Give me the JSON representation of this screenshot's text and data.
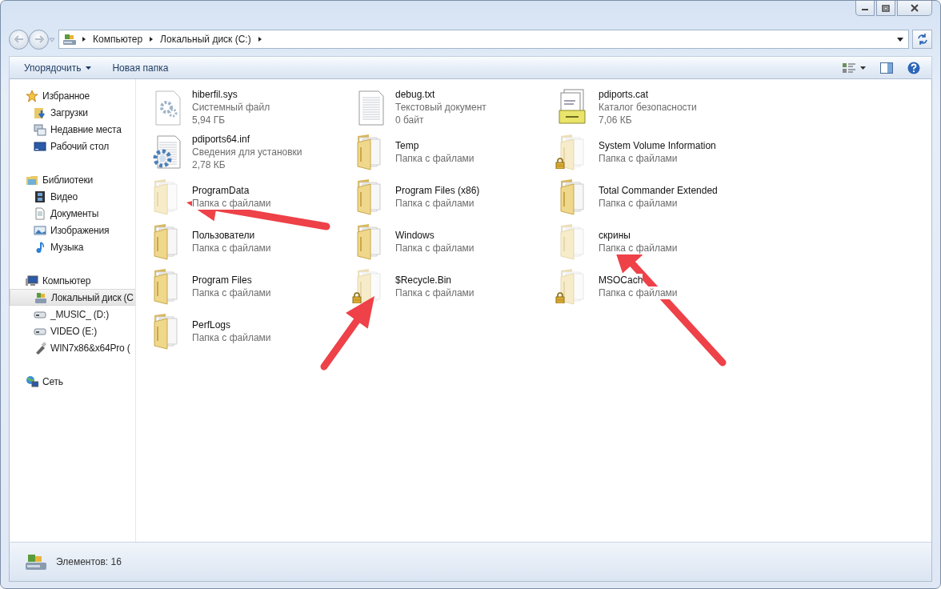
{
  "address_bar": {
    "path": [
      {
        "label": "Компьютер"
      },
      {
        "label": "Локальный диск (C:)"
      }
    ]
  },
  "toolbar": {
    "organize": "Упорядочить",
    "new_folder": "Новая папка"
  },
  "navigation": [
    {
      "label": "Избранное",
      "kind": "favorites",
      "selected": false,
      "children": [
        {
          "label": "Загрузки",
          "kind": "downloads",
          "selected": false
        },
        {
          "label": "Недавние места",
          "kind": "recent",
          "selected": false
        },
        {
          "label": "Рабочий стол",
          "kind": "desktop",
          "selected": false
        }
      ]
    },
    {
      "label": "Библиотеки",
      "kind": "libraries",
      "selected": false,
      "children": [
        {
          "label": "Видео",
          "kind": "video",
          "selected": false
        },
        {
          "label": "Документы",
          "kind": "documents",
          "selected": false
        },
        {
          "label": "Изображения",
          "kind": "pictures",
          "selected": false
        },
        {
          "label": "Музыка",
          "kind": "music",
          "selected": false
        }
      ]
    },
    {
      "label": "Компьютер",
      "kind": "computer",
      "selected": false,
      "children": [
        {
          "label": "Локальный диск (C",
          "kind": "system-drive",
          "selected": true
        },
        {
          "label": "_MUSIC_ (D:)",
          "kind": "drive",
          "selected": false
        },
        {
          "label": "VIDEO (E:)",
          "kind": "drive",
          "selected": false
        },
        {
          "label": "WIN7x86&x64Pro (",
          "kind": "usb",
          "selected": false
        }
      ]
    },
    {
      "label": "Сеть",
      "kind": "network",
      "selected": false
    }
  ],
  "columns": [
    [
      {
        "name": "hiberfil.sys",
        "kind": "system-file",
        "details": [
          "Системный файл",
          "5,94 ГБ"
        ],
        "hidden": false,
        "locked": false
      },
      {
        "name": "pdiports64.inf",
        "kind": "setup-file",
        "details": [
          "Сведения для установки",
          "2,78 КБ"
        ],
        "hidden": false,
        "locked": false
      },
      {
        "name": "ProgramData",
        "kind": "folder",
        "details": [
          "Папка с файлами"
        ],
        "hidden": true,
        "locked": false
      },
      {
        "name": "Пользователи",
        "kind": "folder",
        "details": [
          "Папка с файлами"
        ],
        "hidden": false,
        "locked": false
      },
      {
        "name": "Program Files",
        "kind": "folder",
        "details": [
          "Папка с файлами"
        ],
        "hidden": false,
        "locked": false
      },
      {
        "name": "PerfLogs",
        "kind": "folder",
        "details": [
          "Папка с файлами"
        ],
        "hidden": false,
        "locked": false
      }
    ],
    [
      {
        "name": "debug.txt",
        "kind": "text-file",
        "details": [
          "Текстовый документ",
          "0 байт"
        ],
        "hidden": false,
        "locked": false
      },
      {
        "name": "Temp",
        "kind": "folder",
        "details": [
          "Папка с файлами"
        ],
        "hidden": false,
        "locked": false
      },
      {
        "name": "Program Files (x86)",
        "kind": "folder",
        "details": [
          "Папка с файлами"
        ],
        "hidden": false,
        "locked": false
      },
      {
        "name": "Windows",
        "kind": "folder",
        "details": [
          "Папка с файлами"
        ],
        "hidden": false,
        "locked": false
      },
      {
        "name": "$Recycle.Bin",
        "kind": "folder",
        "details": [
          "Папка с файлами"
        ],
        "hidden": true,
        "locked": true
      }
    ],
    [
      {
        "name": "pdiports.cat",
        "kind": "catalog-file",
        "details": [
          "Каталог безопасности",
          "7,06 КБ"
        ],
        "hidden": false,
        "locked": false
      },
      {
        "name": "System Volume Information",
        "kind": "folder",
        "details": [
          "Папка с файлами"
        ],
        "hidden": true,
        "locked": true
      },
      {
        "name": "Total Commander Extended",
        "kind": "folder",
        "details": [
          "Папка с файлами"
        ],
        "hidden": false,
        "locked": false
      },
      {
        "name": "скрины",
        "kind": "folder",
        "details": [
          "Папка с файлами"
        ],
        "hidden": true,
        "locked": false
      },
      {
        "name": "MSOCach",
        "kind": "folder",
        "details": [
          "Папка с файлами"
        ],
        "hidden": true,
        "locked": true
      }
    ]
  ],
  "status_bar": {
    "count": "Элементов: 16"
  }
}
